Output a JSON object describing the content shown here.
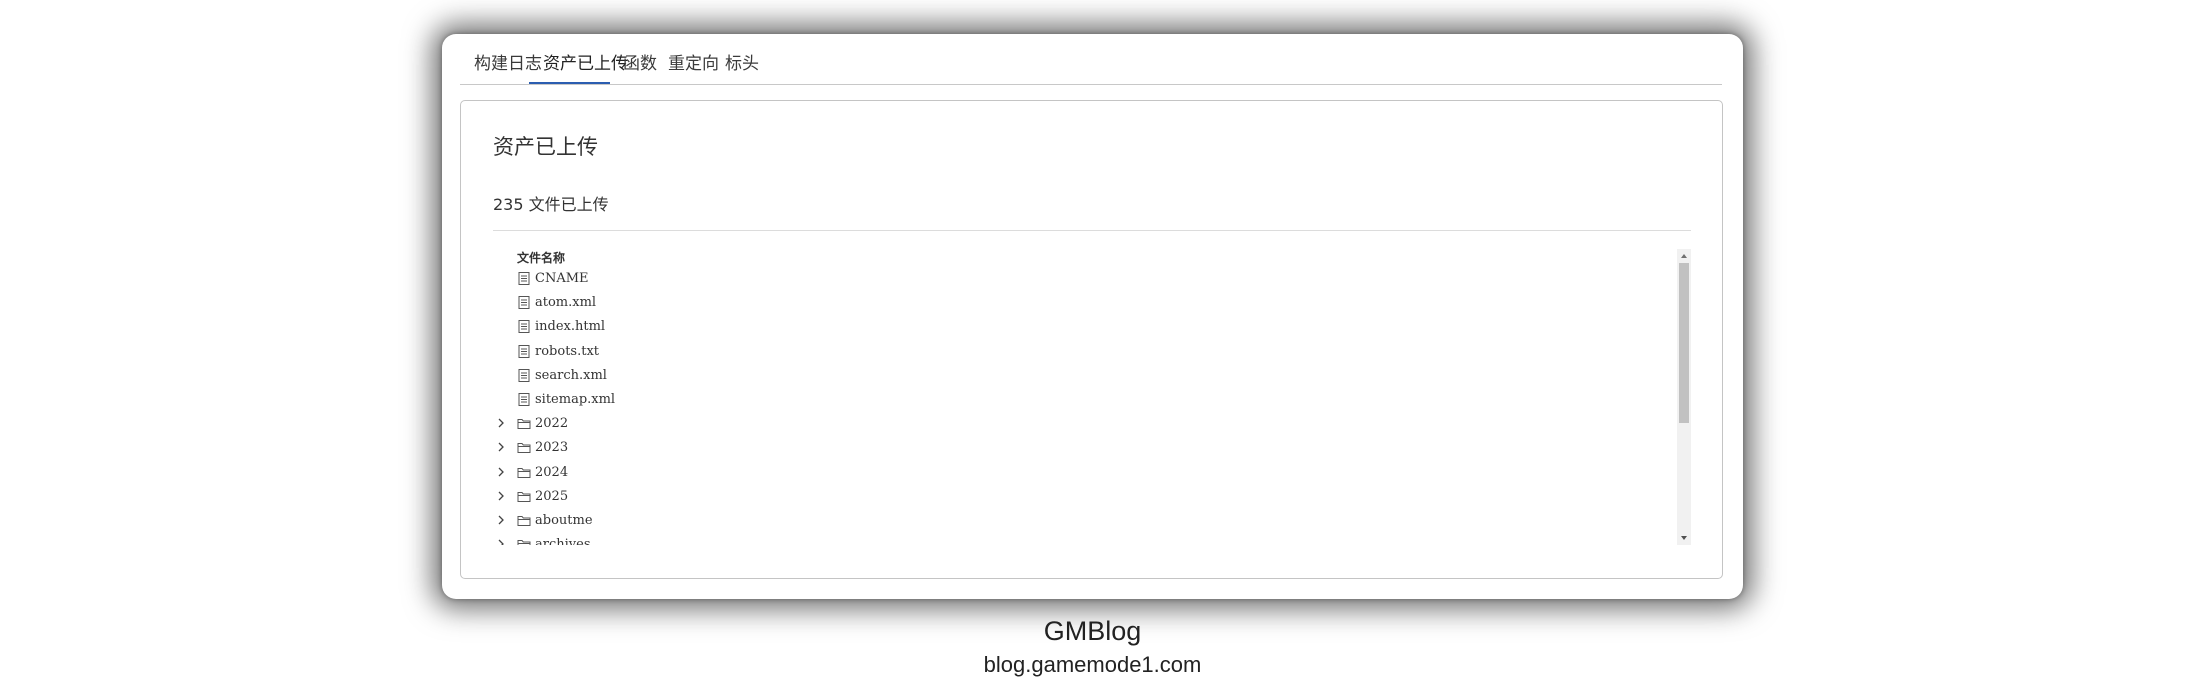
{
  "tabs": [
    {
      "label": "构建日志",
      "icon": ""
    },
    {
      "label": "资产已上传",
      "icon": ""
    },
    {
      "label": "函数",
      "icon": ""
    },
    {
      "label": "重定向",
      "icon": ""
    },
    {
      "label": "标头",
      "icon": ""
    }
  ],
  "active_tab": "资产已上传",
  "panel": {
    "title": "资产已上传",
    "count_text": "235 文件已上传"
  },
  "tree": {
    "header": "文件名称",
    "items": [
      {
        "name": "CNAME",
        "type": "file"
      },
      {
        "name": "atom.xml",
        "type": "file"
      },
      {
        "name": "index.html",
        "type": "file"
      },
      {
        "name": "robots.txt",
        "type": "file"
      },
      {
        "name": "search.xml",
        "type": "file"
      },
      {
        "name": "sitemap.xml",
        "type": "file"
      },
      {
        "name": "2022",
        "type": "folder"
      },
      {
        "name": "2023",
        "type": "folder"
      },
      {
        "name": "2024",
        "type": "folder"
      },
      {
        "name": "2025",
        "type": "folder"
      },
      {
        "name": "aboutme",
        "type": "folder"
      },
      {
        "name": "archives",
        "type": "folder"
      }
    ]
  },
  "footer": {
    "title": "GMBlog",
    "url": "blog.gamemode1.com"
  },
  "colors": {
    "active_tab_underline": "#2b5db0",
    "scrollbar_thumb": "#c1c1c1"
  }
}
